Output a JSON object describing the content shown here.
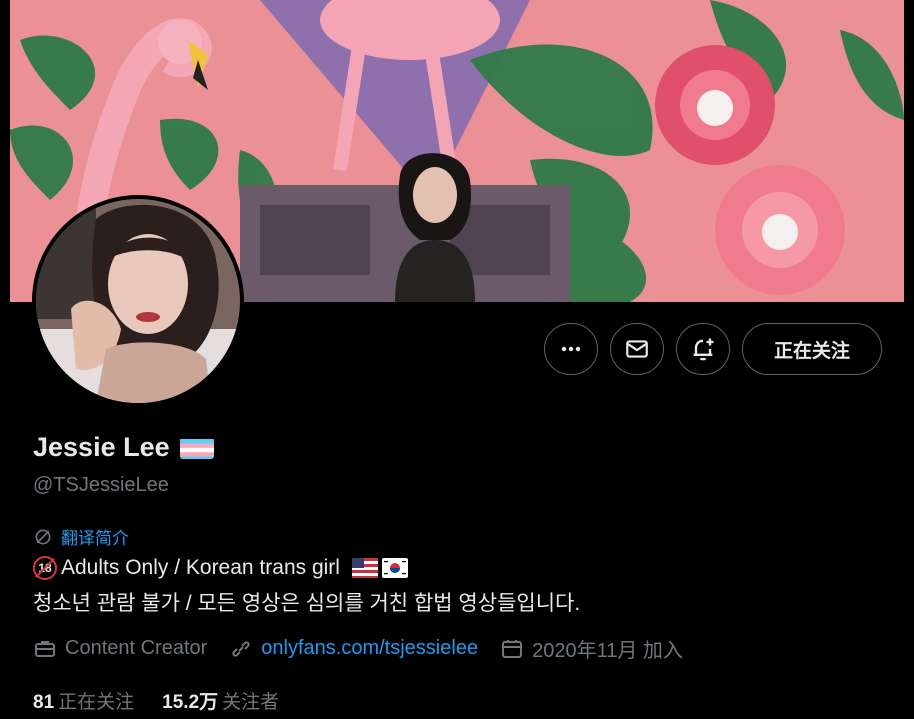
{
  "profile": {
    "name": "Jessie Lee",
    "handle": "@TSJessieLee",
    "translate_bio": "翻译简介",
    "bio_line1": "Adults Only / Korean trans girl",
    "bio_line2": "청소년 관람 불가 / 모든 영상은 심의를 거친 합법 영상들입니다.",
    "badge_18": "18"
  },
  "meta": {
    "category": "Content Creator",
    "link": "onlyfans.com/tsjessielee",
    "joined": "2020年11月 加入"
  },
  "stats": {
    "following_count": "81",
    "following_label": "正在关注",
    "followers_count": "15.2万",
    "followers_label": "关注者"
  },
  "actions": {
    "follow_label": "正在关注"
  },
  "icons": [
    "more-icon",
    "mail-icon",
    "bell-plus-icon",
    "translate-icon",
    "briefcase-icon",
    "link-icon",
    "calendar-icon"
  ],
  "colors": {
    "accent": "#1d9bf0",
    "muted": "#71767b",
    "text": "#e7e9ea",
    "border": "#536471"
  }
}
